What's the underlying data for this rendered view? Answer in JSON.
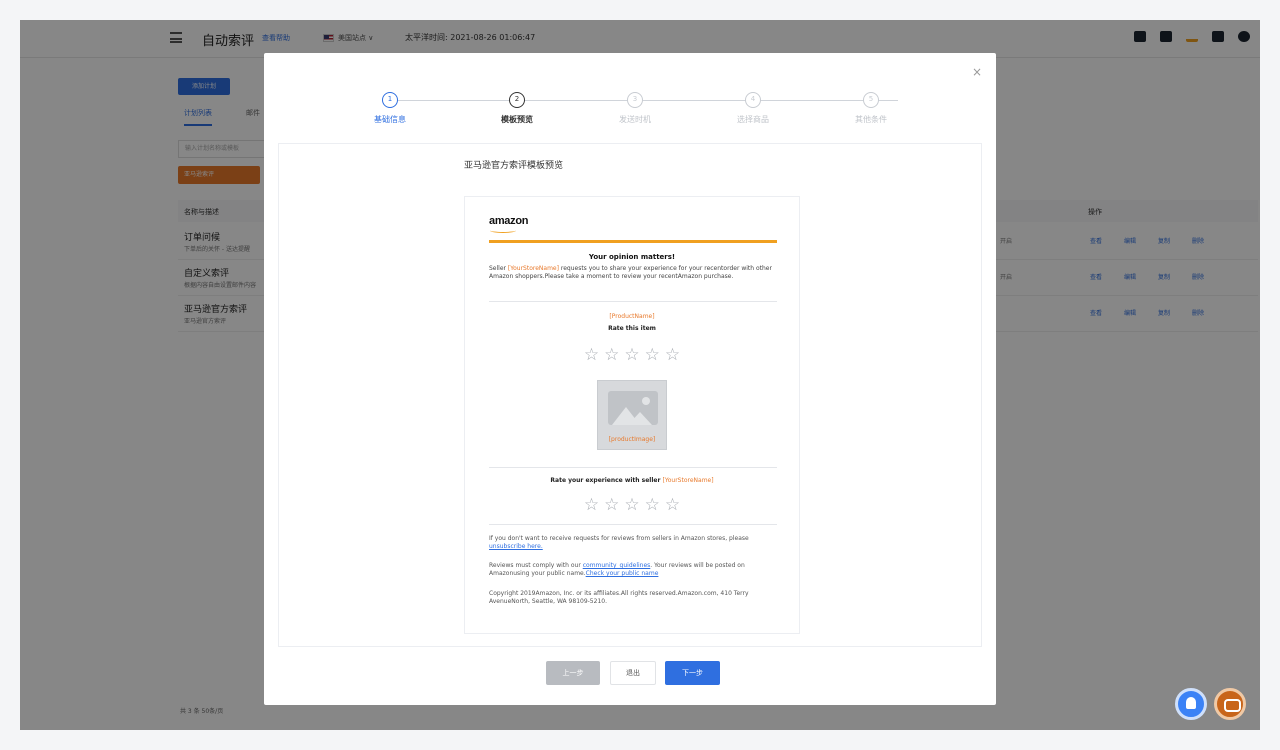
{
  "app": {
    "title": "自动索评",
    "help": "查看帮助",
    "region": "美国站点 ∨",
    "time": "太平洋时间: 2021-08-26 01:06:47"
  },
  "background": {
    "button": "添加计划",
    "tabs": [
      "计划列表",
      "邮件"
    ],
    "search_placeholder": "输入计划名称或模板",
    "action_button": "亚马逊索评",
    "col_name": "名称与描述",
    "col_ops": "操作",
    "rows": [
      {
        "title": "订单问候",
        "sub": "下单后的关怀 - 送达提醒",
        "status": "开启"
      },
      {
        "title": "自定义索评",
        "sub": "根据内容自由设置邮件内容",
        "status": "开启"
      },
      {
        "title": "亚马逊官方索评",
        "sub": "亚马逊官方索评",
        "status": ""
      }
    ],
    "row_ops": [
      "查看",
      "编辑",
      "复制",
      "删除"
    ],
    "pager": "共 3 条      50条/页"
  },
  "modal": {
    "close": "×",
    "steps": [
      {
        "num": "1",
        "label": "基础信息"
      },
      {
        "num": "2",
        "label": "模板预览"
      },
      {
        "num": "3",
        "label": "发送时机"
      },
      {
        "num": "4",
        "label": "选择商品"
      },
      {
        "num": "5",
        "label": "其他条件"
      }
    ],
    "preview_title": "亚马逊官方索评模板预览",
    "buttons": {
      "prev": "上一步",
      "exit": "退出",
      "next": "下一步"
    }
  },
  "email": {
    "logo": "amazon",
    "headline": "Your opinion matters!",
    "intro_prefix": "Seller ",
    "store_name": "[YourStoreName]",
    "intro_suffix": " requests you to share your experience for your recentorder with other Amazon shoppers.Please take a moment to review your recentAmazon purchase.",
    "product_name": "[ProductName]",
    "rate_item": "Rate this item",
    "product_image_caption": "[productImage]",
    "rate_seller_prefix": "Rate your experience with seller ",
    "unsubscribe_text": "If you don't want to receive requests for reviews from sellers in Amazon stores, please ",
    "unsubscribe_link": "unsubscribe here.",
    "guidelines_prefix": "Reviews must comply with our ",
    "guidelines_link": "community_guidelines",
    "guidelines_middle": ". Your reviews will be posted on Amazonusing your public name.",
    "public_name_link": "Check your public name",
    "copyright": "Copyright 2019Amazon, Inc. or its affiliates.All rights reserved.Amazon.com, 410 Terry AvenueNorth, Seattle, WA 98109-5210."
  },
  "colors": {
    "primary": "#2f6fe0",
    "amazon_orange": "#f0a020",
    "placeholder_orange": "#e8792b"
  }
}
